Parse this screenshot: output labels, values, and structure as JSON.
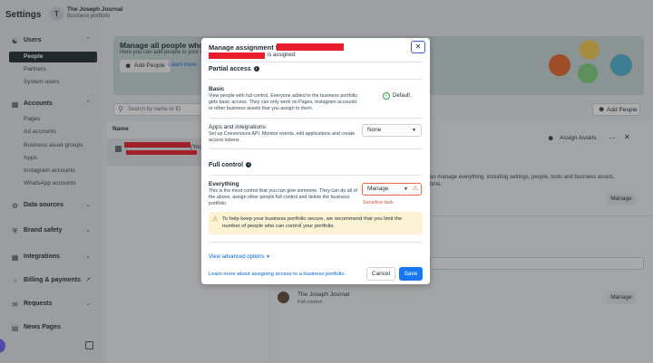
{
  "sidebar": {
    "title": "Settings",
    "business_initial": "T",
    "business_name": "The Joseph Journal",
    "business_type": "Business portfolio",
    "users_label": "Users",
    "users_items": [
      "People",
      "Partners",
      "System users"
    ],
    "accounts_label": "Accounts",
    "accounts_items": [
      "Pages",
      "Ad accounts",
      "Business asset groups",
      "Apps",
      "Instagram accounts",
      "WhatsApp accounts"
    ],
    "data_sources_label": "Data sources",
    "brand_safety_label": "Brand safety",
    "integrations_label": "Integrations",
    "billing_label": "Billing & payments",
    "requests_label": "Requests",
    "news_pages_label": "News Pages"
  },
  "banner": {
    "title": "Manage all people who hel",
    "subtitle": "Here you can add people to your business p",
    "add_button": "Add People",
    "learn": "Learn more"
  },
  "search": {
    "placeholder": "Search by name or ID"
  },
  "list": {
    "add_people": "Add People",
    "column_name": "Name",
    "row_suffix": "(You"
  },
  "detail": {
    "assign_label": "Assign Assets",
    "desc_line1": "an manage everything, including settings, people, tools and business assets.",
    "desc_line2": "time.",
    "manage_label": "Manage",
    "portfolio_name": "The Joseph Journal",
    "portfolio_role": "Full control",
    "manage_label_2": "Manage"
  },
  "modal": {
    "title_prefix": "Manage assignment for",
    "subtitle_tail": "is assigned:",
    "partial_access": "Partial access",
    "basic_label": "Basic",
    "basic_desc": "View people with full control. Everyone added to the business portfolio gets basic access. They can only work on Pages, Instagram accounts or other business assets that you assign to them.",
    "default_label": "Default",
    "apps_label": "Apps and integrations",
    "apps_desc": "Set up Conversions API. Monitor events, edit applications and create access tokens.",
    "apps_select_value": "None",
    "full_control": "Full control",
    "everything_label": "Everything",
    "everything_desc": "This is the most control that you can give someone. They can do all of the above, assign other people full control and delete the business portfolio.",
    "everything_select_value": "Manage",
    "sensitive_label": "Sensitive task",
    "alert_text": "To help keep your business portfolio secure, we recommend that you limit the number of people who can control your portfolio.",
    "advanced_options": "View advanced options",
    "learn_more": "Learn more about assigning access to a business portfolio.",
    "cancel": "Cancel",
    "save": "Save"
  },
  "colors": {
    "primary": "#1877f2",
    "link": "#0064e0",
    "warning_bg": "#fdf2d4",
    "sensitive": "#d4583c",
    "redaction": "#ea1d2c"
  }
}
